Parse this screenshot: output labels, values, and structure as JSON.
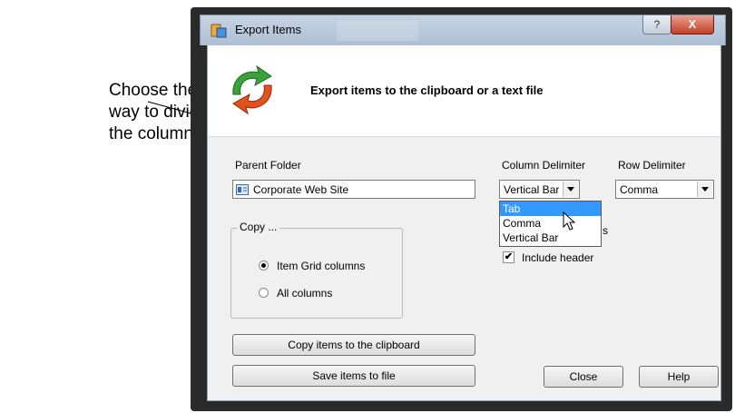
{
  "callout": {
    "line1": "Choose the",
    "line2": "way to divide",
    "line3": "the columns."
  },
  "window": {
    "title": "Export Items",
    "help_glyph": "?",
    "close_glyph": "X",
    "heading": "Export items to the clipboard or a text file"
  },
  "form": {
    "parent_folder_label": "Parent Folder",
    "parent_folder_value": "Corporate Web Site",
    "column_delimiter_label": "Column Delimiter",
    "column_delimiter_value": "Vertical Bar",
    "row_delimiter_label": "Row Delimiter",
    "row_delimiter_value": "Comma",
    "dropdown_options": [
      "Tab",
      "Comma",
      "Vertical Bar"
    ],
    "partial_text": "s",
    "copy_group_title": "Copy ...",
    "radio_grid": "Item Grid columns",
    "radio_all": "All columns",
    "include_header_label": "Include header",
    "include_header_checked": true,
    "check_glyph": "✔"
  },
  "buttons": {
    "copy_clipboard": "Copy items to the clipboard",
    "save_file": "Save items to file",
    "close": "Close",
    "help": "Help"
  },
  "colors": {
    "selection": "#3399ff",
    "close_button": "#c4402a",
    "title_bar": "#b9c8da"
  }
}
